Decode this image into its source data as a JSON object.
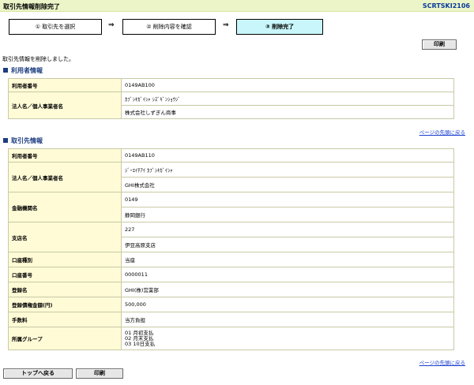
{
  "header": {
    "title": "取引先情報削除完了",
    "screen_code": "SCRTSKI2106"
  },
  "steps": [
    "① 取引先を選択",
    "② 削除内容を確認",
    "③ 削除完了"
  ],
  "arrow": "⇒",
  "print_label": "印刷",
  "message": "取引先情報を削除しました。",
  "user_section": {
    "title": "利用者情報",
    "rows": [
      {
        "label": "利用者番号",
        "values": [
          "0149AB100"
        ]
      },
      {
        "label": "法人名／個人事業者名",
        "values": [
          "ｶﾌﾞｼｷｶﾞｲｼｬ ｼｽﾞｷﾞﾝｼｮｳｼﾞ",
          "株式会社しずぎん商事"
        ]
      }
    ]
  },
  "back_to_top": "ページの先頭に戻る",
  "partner_section": {
    "title": "取引先情報",
    "rows": [
      {
        "label": "利用者番号",
        "values": [
          "0149AB110"
        ]
      },
      {
        "label": "法人名／個人事業者名",
        "values": [
          "ｼﾞｰｴｲﾁｱｲ ｶﾌﾞｼｷｶﾞｲｼｬ",
          "GHI株式会社"
        ]
      },
      {
        "label": "金融機関名",
        "values": [
          "0149",
          "静岡銀行"
        ]
      },
      {
        "label": "支店名",
        "values": [
          "227",
          "伊豆高原支店"
        ]
      },
      {
        "label": "口座種別",
        "values": [
          "当座"
        ]
      },
      {
        "label": "口座番号",
        "values": [
          "0000011"
        ]
      },
      {
        "label": "登録名",
        "values": [
          "GHI(株)営業部"
        ]
      },
      {
        "label": "登録債権金額(円)",
        "values": [
          "500,000"
        ]
      },
      {
        "label": "手数料",
        "values": [
          "当方負担"
        ]
      },
      {
        "label": "所属グループ",
        "values": [
          "01 月初支払",
          "02 月末支払",
          "03 10日支払"
        ]
      }
    ]
  },
  "footer": {
    "top_button": "トップへ戻る",
    "print_button": "印刷"
  }
}
